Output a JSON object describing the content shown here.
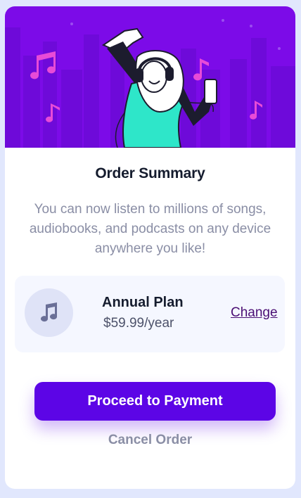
{
  "order": {
    "title": "Order Summary",
    "description": [
      "You can now listen to millions of songs,",
      "audiobooks, and podcasts on any device",
      "anywhere you like!"
    ]
  },
  "plan": {
    "icon": "music-note-icon",
    "name": "Annual Plan",
    "price": "$59.99/year",
    "change_label": "Change"
  },
  "actions": {
    "proceed_label": "Proceed to Payment",
    "cancel_label": "Cancel Order"
  },
  "colors": {
    "page_background": "#e1e7fd",
    "hero_background": "#7c0be8",
    "primary_button": "#5c05e6",
    "change_link": "#4a0e74",
    "muted_text": "#8a8ea5",
    "heading_text": "#151c2e"
  }
}
